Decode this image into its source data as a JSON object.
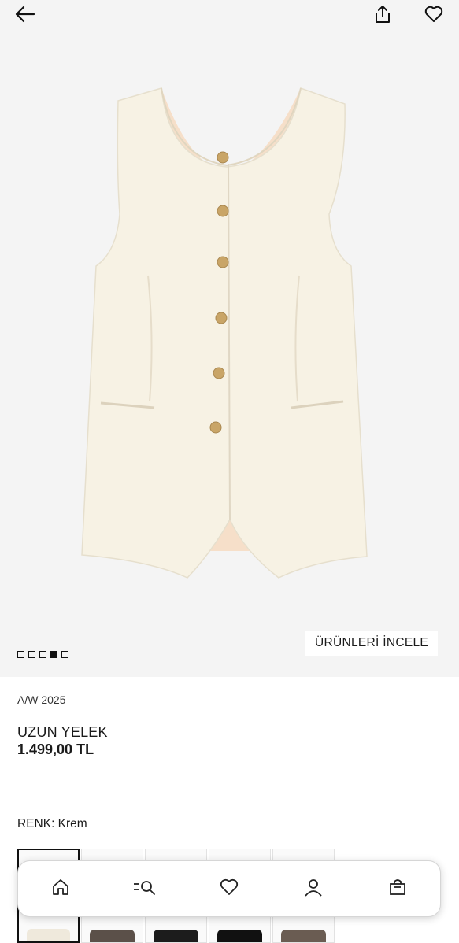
{
  "product": {
    "season": "A/W 2025",
    "name": "UZUN YELEK",
    "price": "1.499,00 TL",
    "color_label": "RENK: Krem"
  },
  "gallery": {
    "inspect_label": "ÜRÜNLERİ İNCELE",
    "image_count": 5,
    "active_index": 3
  },
  "swatches": [
    {
      "color": "#efe9dc",
      "selected": true
    },
    {
      "color": "#5b5049",
      "selected": false
    },
    {
      "color": "#1c1c1c",
      "selected": false
    },
    {
      "color": "#111111",
      "selected": false
    },
    {
      "color": "#6a5c52",
      "selected": false
    }
  ],
  "icons": {
    "back": "arrow-left-icon",
    "share": "share-icon",
    "favorite": "heart-icon",
    "nav": [
      "home-icon",
      "search-icon",
      "heart-icon",
      "user-icon",
      "bag-icon"
    ]
  },
  "colors": {
    "hero_bg": "#f4f4f4",
    "vest": "#f7f2e4",
    "lining": "#f6dfc9",
    "button": "#c9a567"
  }
}
